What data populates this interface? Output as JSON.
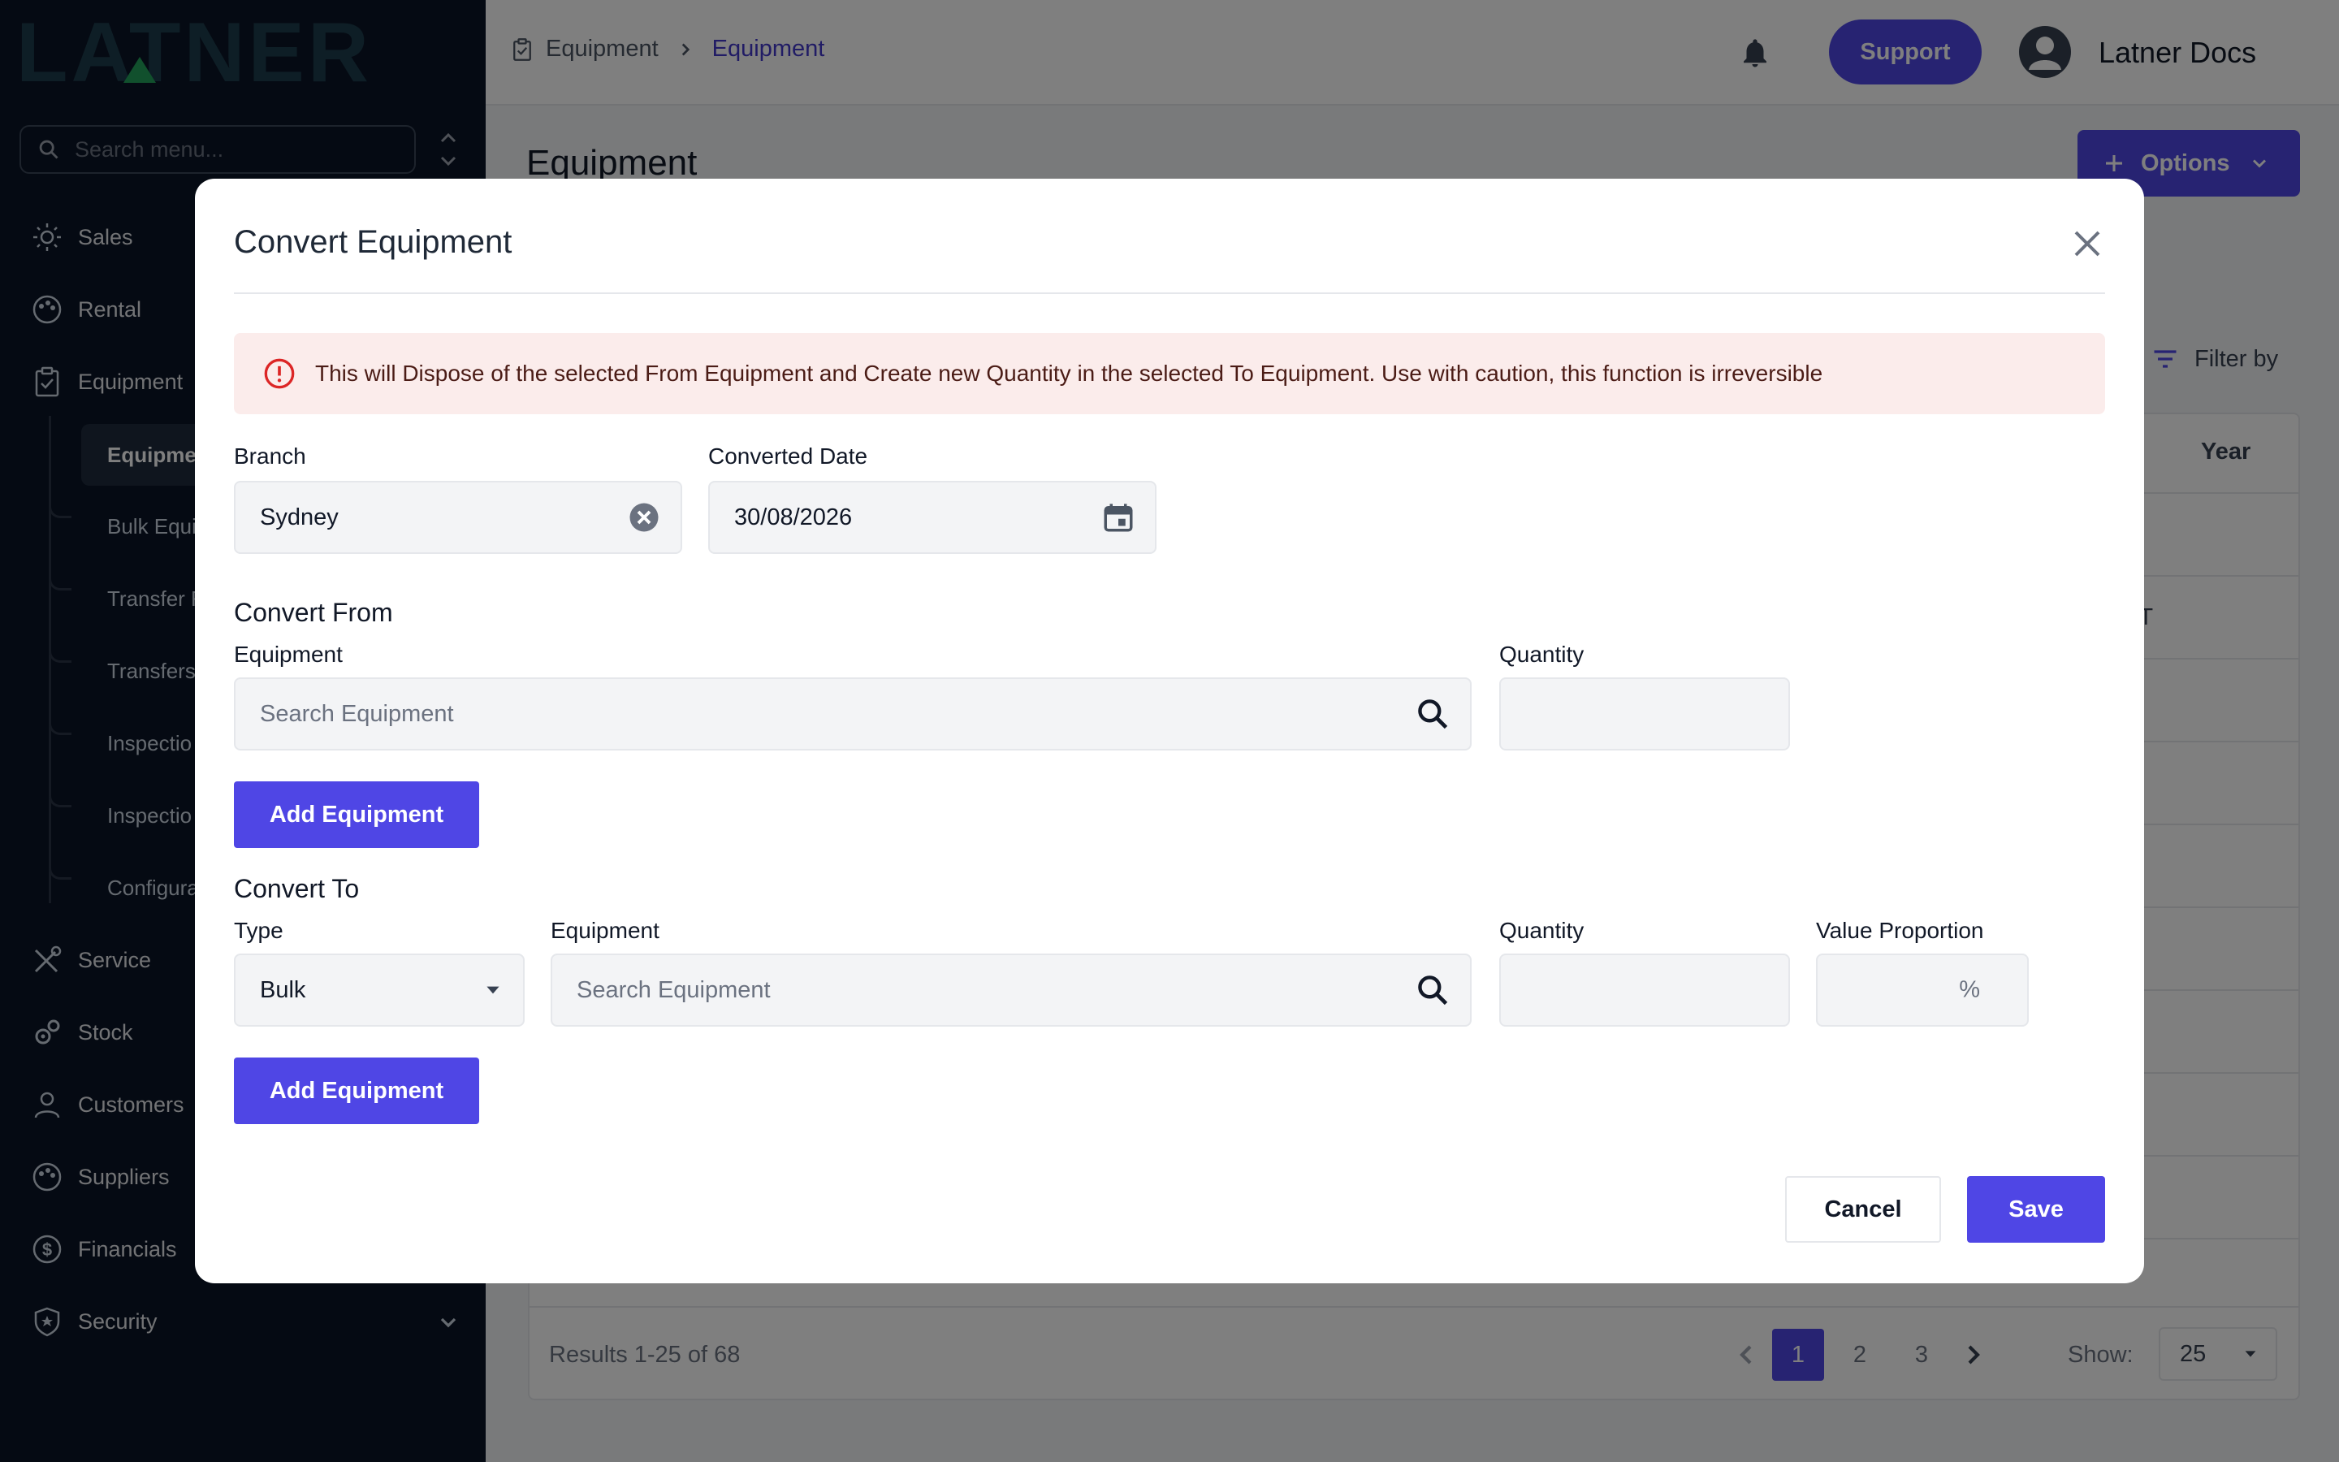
{
  "app": {
    "logo_text": "LATNER",
    "colors": {
      "accent": "#4f46e5",
      "sidebar": "#0b1526",
      "alert_bg": "#fbeceb",
      "alert_icon": "#dc2626"
    }
  },
  "sidebar": {
    "search_placeholder": "Search menu...",
    "items": [
      {
        "label": "Sales",
        "icon": "sun-icon"
      },
      {
        "label": "Rental",
        "icon": "palette-icon"
      },
      {
        "label": "Equipment",
        "icon": "clipboard-icon"
      },
      {
        "label": "Service",
        "icon": "tools-icon"
      },
      {
        "label": "Stock",
        "icon": "gears-icon"
      },
      {
        "label": "Customers",
        "icon": "person-icon"
      },
      {
        "label": "Suppliers",
        "icon": "palette-icon"
      },
      {
        "label": "Financials",
        "icon": "dollar-icon"
      },
      {
        "label": "Security",
        "icon": "shield-icon"
      }
    ],
    "sub_items": [
      "Equipme",
      "Bulk Equi",
      "Transfer F",
      "Transfers",
      "Inspectio",
      "Inspectio",
      "Configura"
    ]
  },
  "header": {
    "breadcrumb": [
      "Equipment",
      "Equipment"
    ],
    "support_label": "Support",
    "user_name": "Latner Docs"
  },
  "page": {
    "title": "Equipment",
    "options_label": "Options",
    "filter_label": "Filter by",
    "col_year": "Year",
    "partial_cell": "ET",
    "results_text": "Results 1-25 of 68",
    "pages": [
      "1",
      "2",
      "3"
    ],
    "show_label": "Show:",
    "show_value": "25"
  },
  "modal": {
    "title": "Convert Equipment",
    "alert": "This will Dispose of the selected From Equipment and Create new Quantity in the selected To Equipment. Use with caution, this function is irreversible",
    "branch_label": "Branch",
    "branch_value": "Sydney",
    "date_label": "Converted Date",
    "date_value": "30/08/2026",
    "convert_from": {
      "title": "Convert From",
      "equipment_label": "Equipment",
      "equipment_placeholder": "Search Equipment",
      "quantity_label": "Quantity",
      "add_label": "Add Equipment"
    },
    "convert_to": {
      "title": "Convert To",
      "type_label": "Type",
      "type_value": "Bulk",
      "equipment_label": "Equipment",
      "equipment_placeholder": "Search Equipment",
      "quantity_label": "Quantity",
      "value_label": "Value Proportion",
      "value_suffix": "%",
      "add_label": "Add Equipment"
    },
    "cancel_label": "Cancel",
    "save_label": "Save"
  }
}
